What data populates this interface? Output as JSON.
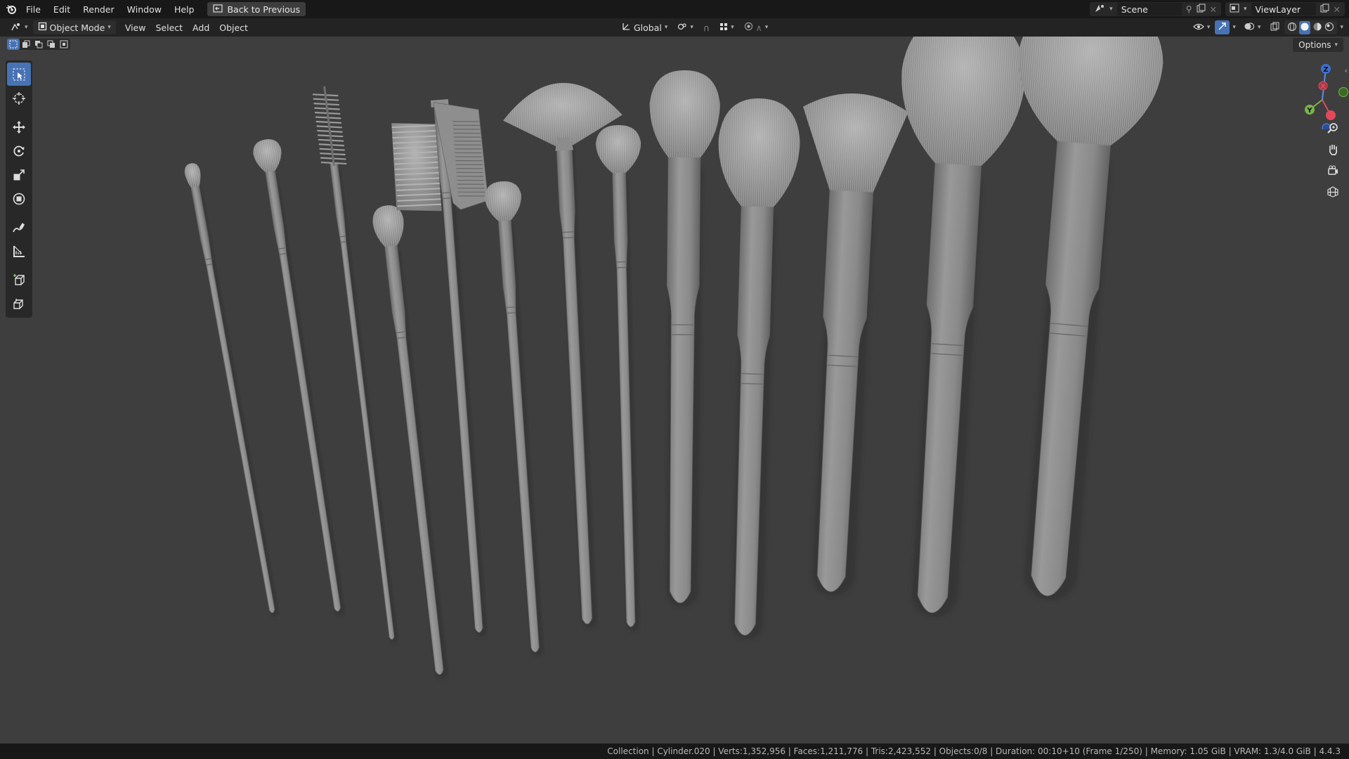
{
  "topbar": {
    "logo_icon": "blender-logo-icon",
    "menus": [
      "File",
      "Edit",
      "Render",
      "Window",
      "Help"
    ],
    "back_button": "Back to Previous",
    "scene_name": "Scene",
    "view_layer": "ViewLayer"
  },
  "header": {
    "editor_type_icon": "3d-viewport-icon",
    "mode": "Object Mode",
    "menus": [
      "View",
      "Select",
      "Add",
      "Object"
    ],
    "orientation": "Global"
  },
  "viewport": {
    "options_label": "Options",
    "select_modes": [
      "select-new-icon",
      "select-extend-icon",
      "select-subtract-icon",
      "select-invert-icon",
      "select-intersect-icon"
    ],
    "tools": [
      "select-box-icon",
      "cursor-icon",
      "move-icon",
      "rotate-icon",
      "scale-icon",
      "transform-icon",
      "annotate-icon",
      "measure-icon",
      "add-cube-icon",
      "extrude-icon"
    ],
    "gizmo_axes": [
      "Z",
      "X",
      "Y"
    ],
    "nav_buttons": [
      "zoom-icon",
      "pan-hand-icon",
      "camera-icon",
      "ortho-grid-icon"
    ],
    "colors": {
      "background": "#3e3e3e",
      "model": "#8a8a8a",
      "accent": "#4772b3"
    }
  },
  "statusbar": {
    "text": "Collection | Cylinder.020 | Verts:1,352,956 | Faces:1,211,776 | Tris:2,423,552 | Objects:0/8 | Duration: 00:10+10 (Frame 1/250) | Memory: 1.05 GiB | VRAM: 1.3/4.0 GiB | 4.4.3"
  }
}
